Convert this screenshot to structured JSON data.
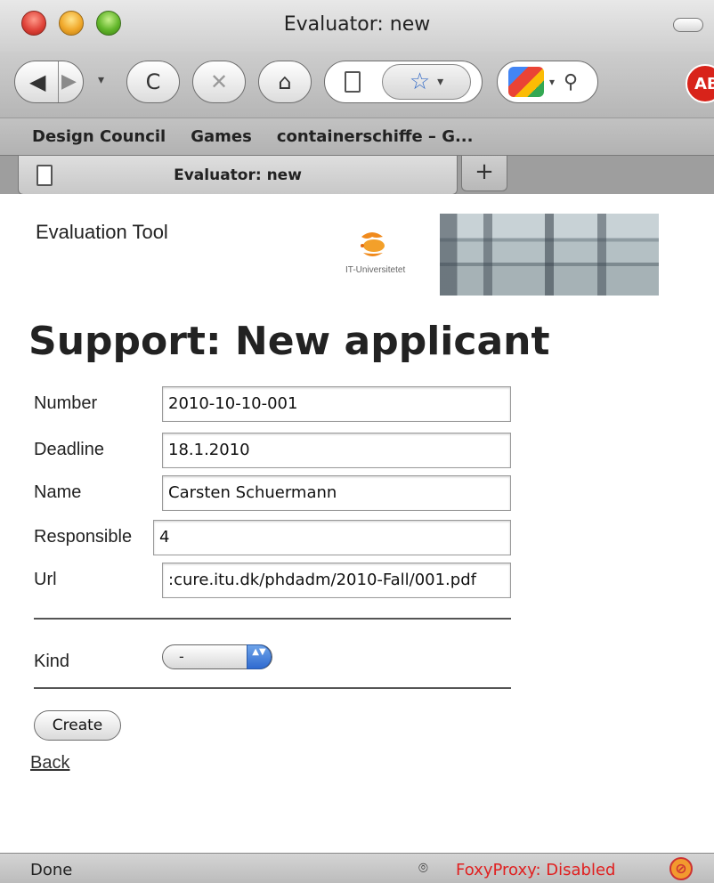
{
  "window": {
    "title": "Evaluator: new"
  },
  "toolbar": {
    "back_icon": "◀",
    "forward_icon": "▶",
    "history_icon": "▾",
    "reload_icon": "C",
    "stop_icon": "✕",
    "home_icon": "⌂",
    "bookmark_star": "☆",
    "bookmark_menu": "▾",
    "search_menu": "▾",
    "search_icon": "⚲",
    "addon_label": "AB"
  },
  "bookmarks": [
    "Design Council",
    "Games",
    "containerschiffe – G..."
  ],
  "tabs": {
    "active_label": "Evaluator: new",
    "new_tab_label": "+"
  },
  "site": {
    "name": "Evaluation Tool",
    "logo_text": "IT-Universitetet"
  },
  "page": {
    "title": "Support: New applicant",
    "fields": [
      {
        "label": "Number",
        "value": "2010-10-10-001"
      },
      {
        "label": "Deadline",
        "value": "18.1.2010"
      },
      {
        "label": "Name",
        "value": "Carsten Schuermann"
      },
      {
        "label": "Responsible",
        "value": "4"
      },
      {
        "label": "Url",
        "value": ":cure.itu.dk/phdadm/2010-Fall/001.pdf"
      }
    ],
    "kind": {
      "label": "Kind",
      "selected": "-",
      "stepper": "▲▼"
    },
    "create_label": "Create",
    "back_label": "Back"
  },
  "status": {
    "text": "Done",
    "proxy_text": "FoxyProxy: Disabled",
    "proxy_icon": "⊘"
  },
  "colors": {
    "proxy_disabled": "#e02020",
    "select_stepper": "#2f6ad0"
  }
}
